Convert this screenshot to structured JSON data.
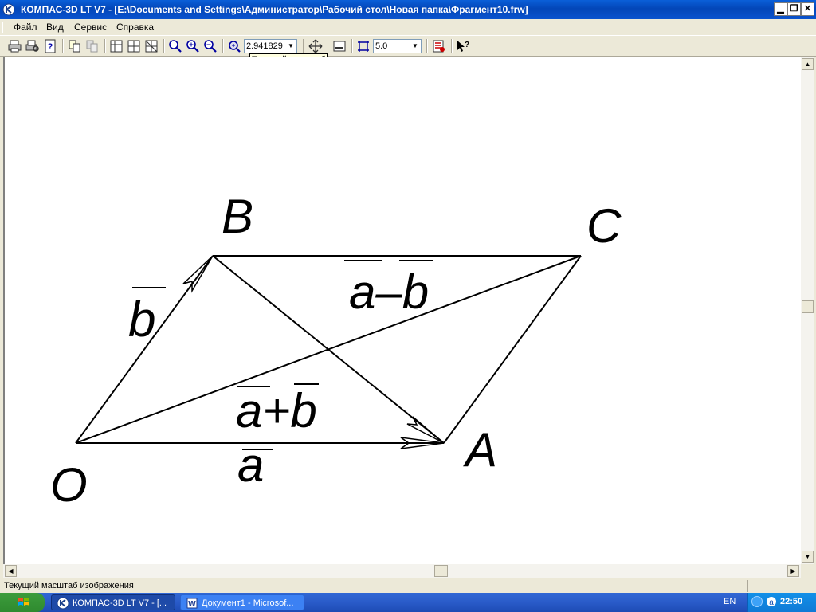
{
  "window": {
    "title": "КОМПАС-3D LT V7 - [E:\\Documents and Settings\\Администратор\\Рабочий стол\\Новая папка\\Фрагмент10.frw]"
  },
  "menu": {
    "items": [
      {
        "label": "Файл"
      },
      {
        "label": "Вид"
      },
      {
        "label": "Сервис"
      },
      {
        "label": "Справка"
      }
    ]
  },
  "toolbar": {
    "icons": [
      "print-icon",
      "print-preview-icon",
      "help-icon",
      "copy-properties-icon",
      "paste-properties-icon",
      "view-layout-1-icon",
      "view-layout-2-icon",
      "view-layout-3-icon",
      "zoom-icon",
      "zoom-in-icon",
      "zoom-out-icon",
      "zoom-window-icon",
      "pan-icon",
      "show-all-icon",
      "snap-step-icon",
      "layers-icon",
      "whats-this-icon"
    ],
    "scale_value": "2.941829",
    "step_value": "5.0",
    "tooltip": "Текущий масштаб"
  },
  "drawing": {
    "labels": {
      "B": "B",
      "C": "C",
      "O": "O",
      "A": "A",
      "b": "b",
      "a_minus_b": "a–b",
      "a_plus_b": "a+b",
      "a": "a"
    }
  },
  "status": {
    "text": "Текущий масштаб изображения"
  },
  "taskbar": {
    "tasks": [
      {
        "label": "КОМПАС-3D LT V7 - [..."
      },
      {
        "label": "Документ1 - Microsof..."
      }
    ],
    "language": "EN",
    "clock": "22:50"
  },
  "colors": {
    "titlebar": "#0a54cf",
    "chrome": "#ece9d8",
    "taskbar": "#2a5bc9",
    "tooltip_bg": "#ffffe1"
  }
}
